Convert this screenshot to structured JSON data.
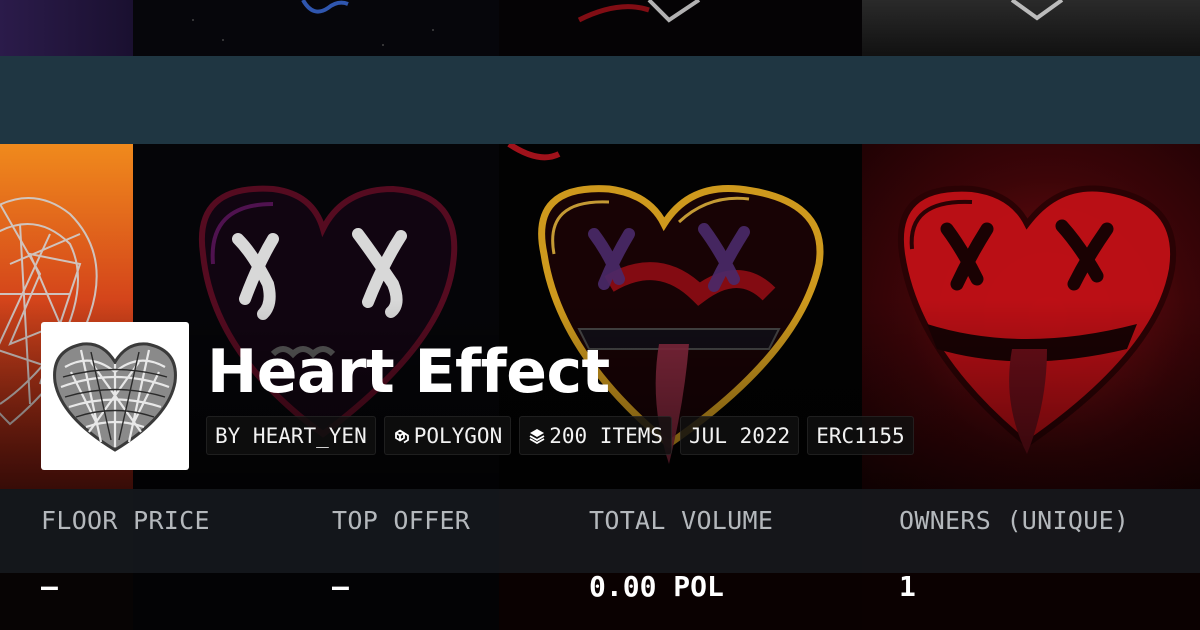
{
  "collection": {
    "name": "Heart Effect",
    "chips": [
      {
        "label": "BY HEART_YEN",
        "icon": ""
      },
      {
        "label": "POLYGON",
        "icon": "polygon-chain-icon"
      },
      {
        "label": "200 ITEMS",
        "icon": "layers-stack-icon"
      },
      {
        "label": "JUL 2022",
        "icon": ""
      },
      {
        "label": "ERC1155",
        "icon": ""
      }
    ]
  },
  "stats": [
    {
      "label": "FLOOR PRICE",
      "value": "–"
    },
    {
      "label": "TOP OFFER",
      "value": "–"
    },
    {
      "label": "TOTAL VOLUME",
      "value": "0.00 POL"
    },
    {
      "label": "OWNERS (UNIQUE)",
      "value": "1"
    }
  ],
  "colors": {
    "band": "#1f3642",
    "stats_bg": "#14181c",
    "stat_label": "#b4b8bc",
    "gold_heart": "#d9a21f",
    "red_heart": "#c01016"
  }
}
